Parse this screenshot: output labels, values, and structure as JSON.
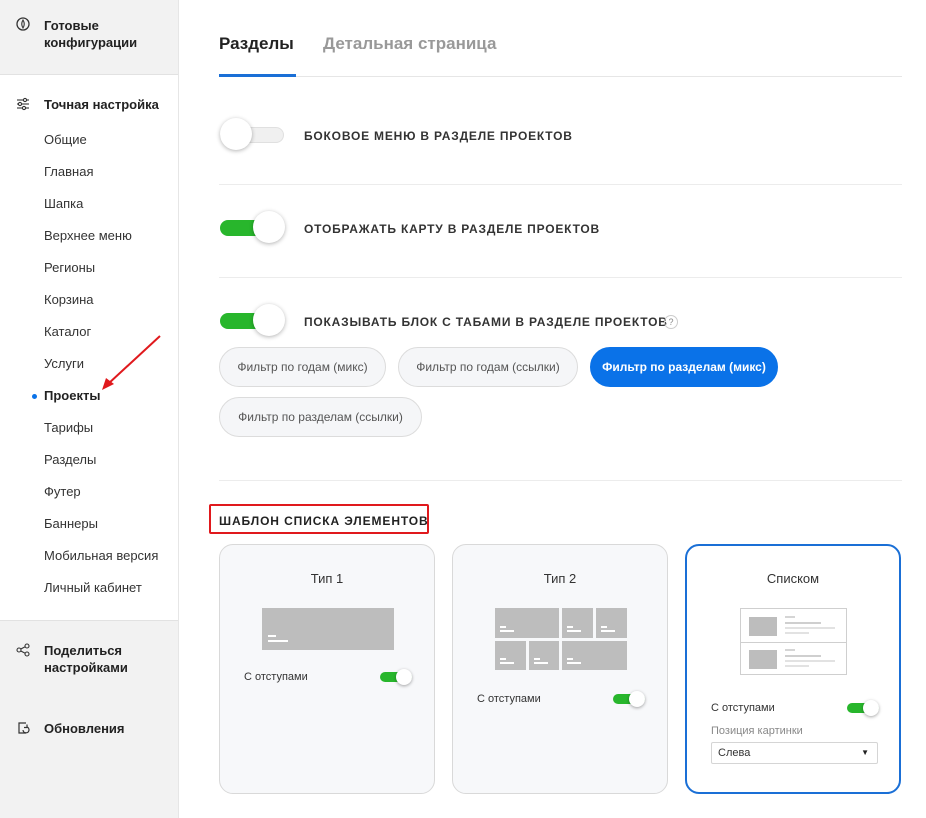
{
  "sidebar": {
    "ready_configs": "Готовые конфигурации",
    "fine_tuning": "Точная настройка",
    "items": [
      "Общие",
      "Главная",
      "Шапка",
      "Верхнее меню",
      "Регионы",
      "Корзина",
      "Каталог",
      "Услуги",
      "Проекты",
      "Тарифы",
      "Разделы",
      "Футер",
      "Баннеры",
      "Мобильная версия",
      "Личный кабинет"
    ],
    "active_item": "Проекты",
    "share_settings": "Поделиться настройками",
    "updates": "Обновления"
  },
  "tabs": [
    "Разделы",
    "Детальная страница"
  ],
  "options": {
    "side_menu": {
      "label": "БОКОВОЕ МЕНЮ В РАЗДЕЛЕ ПРОЕКТОВ",
      "enabled": false
    },
    "show_map": {
      "label": "ОТОБРАЖАТЬ КАРТУ В РАЗДЕЛЕ ПРОЕКТОВ",
      "enabled": true
    },
    "show_tabs": {
      "label": "ПОКАЗЫВАТЬ БЛОК С ТАБАМИ В РАЗДЕЛЕ ПРОЕКТОВ",
      "enabled": true,
      "help": "?"
    }
  },
  "filters": [
    "Фильтр по годам (микс)",
    "Фильтр по годам (ссылки)",
    "Фильтр по разделам (микс)",
    "Фильтр по разделам (ссылки)"
  ],
  "active_filter": "Фильтр по разделам (микс)",
  "template": {
    "title": "ШАБЛОН СПИСКА ЭЛЕМЕНТОВ",
    "cards": [
      {
        "title": "Тип 1",
        "option": "С отступами",
        "selected": false
      },
      {
        "title": "Тип 2",
        "option": "С отступами",
        "selected": false
      },
      {
        "title": "Списком",
        "option": "С отступами",
        "selected": true,
        "image_position_label": "Позиция картинки",
        "image_position_value": "Слева"
      }
    ]
  },
  "colors": {
    "accent": "#0a72e8",
    "toggle_on": "#28b62c",
    "highlight": "#e0191d"
  }
}
